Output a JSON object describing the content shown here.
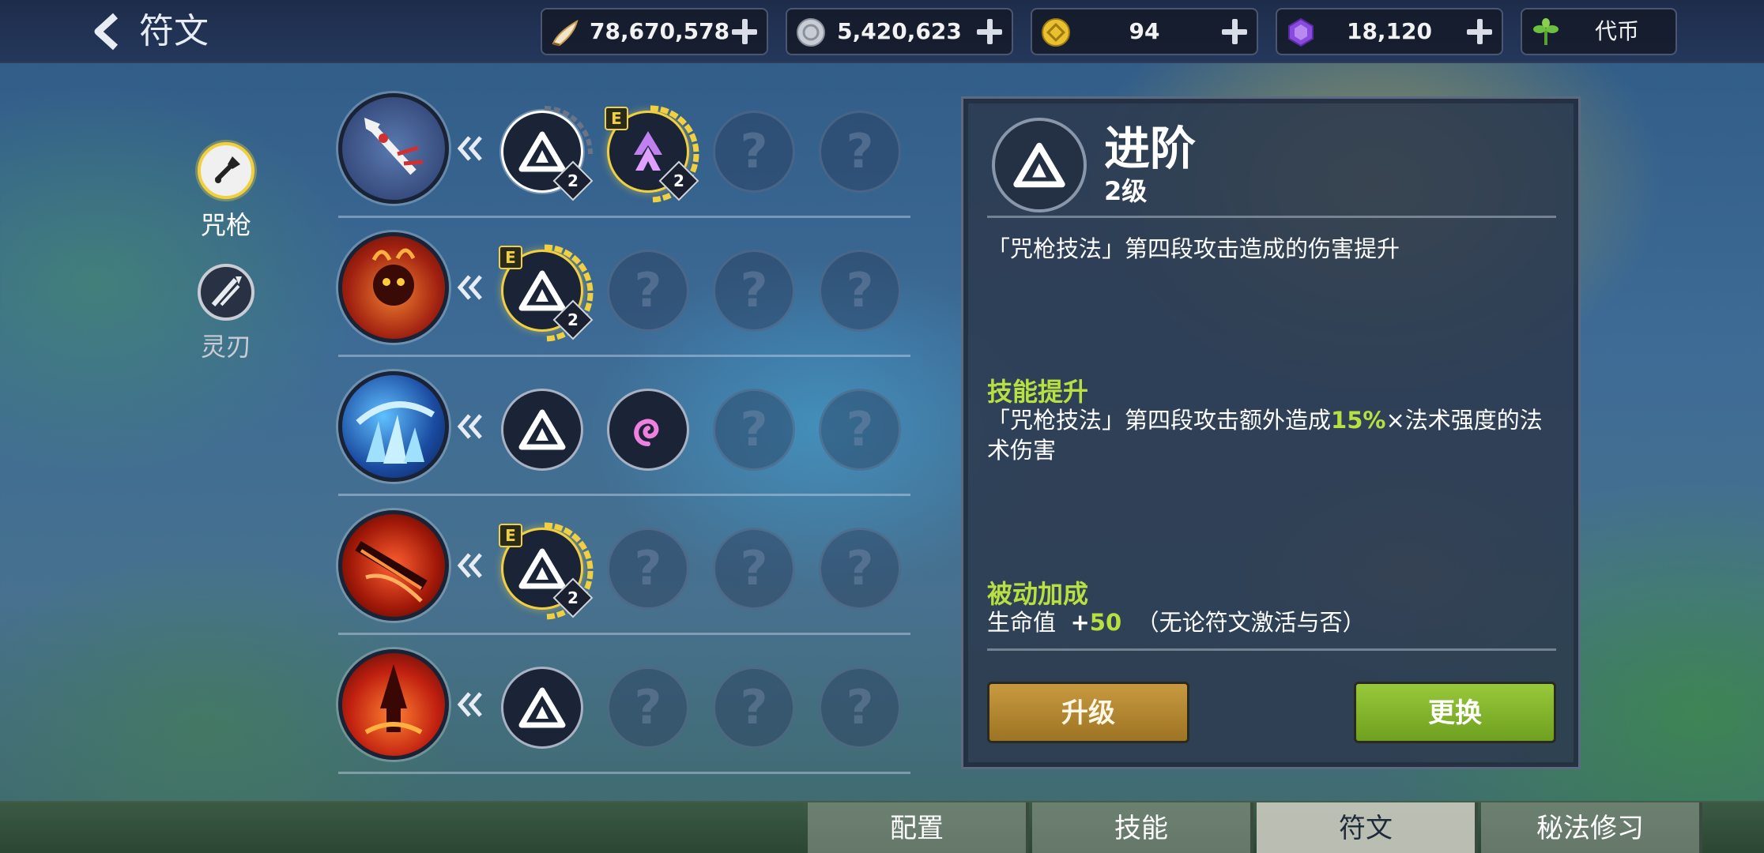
{
  "header": {
    "title": "符文",
    "currencies": [
      {
        "icon": "horn-currency-icon",
        "value": "78,670,578"
      },
      {
        "icon": "silver-coin-icon",
        "value": "5,420,623"
      },
      {
        "icon": "gold-coin-icon",
        "value": "94"
      },
      {
        "icon": "purple-gem-icon",
        "value": "18,120"
      },
      {
        "icon": "sprout-token-icon",
        "value": "代币"
      }
    ]
  },
  "weapons": [
    {
      "label": "咒枪",
      "selected": true
    },
    {
      "label": "灵刃",
      "selected": false
    }
  ],
  "rune_rows": [
    {
      "skill": "spear-skill-icon",
      "slots": [
        {
          "state": "filled",
          "icon": "advance-rune-icon",
          "level": "2",
          "selected": true
        },
        {
          "state": "filled",
          "icon": "purple-arrow-rune-icon",
          "level": "2",
          "badge": "E",
          "gold": true
        },
        {
          "state": "empty",
          "mark": "?"
        },
        {
          "state": "empty",
          "mark": "?"
        }
      ]
    },
    {
      "skill": "fire-spirit-skill-icon",
      "slots": [
        {
          "state": "filled",
          "icon": "advance-rune-icon",
          "level": "2",
          "badge": "E",
          "gold": true
        },
        {
          "state": "empty",
          "mark": "?"
        },
        {
          "state": "empty",
          "mark": "?"
        },
        {
          "state": "empty",
          "mark": "?"
        }
      ]
    },
    {
      "skill": "ice-skill-icon",
      "slots": [
        {
          "state": "filled",
          "icon": "advance-rune-icon"
        },
        {
          "state": "filled",
          "icon": "pink-swirl-rune-icon"
        },
        {
          "state": "empty",
          "mark": "?"
        },
        {
          "state": "empty",
          "mark": "?"
        }
      ]
    },
    {
      "skill": "flame-spear-skill-icon",
      "slots": [
        {
          "state": "filled",
          "icon": "advance-rune-icon",
          "level": "2",
          "badge": "E",
          "gold": true
        },
        {
          "state": "empty",
          "mark": "?"
        },
        {
          "state": "empty",
          "mark": "?"
        },
        {
          "state": "empty",
          "mark": "?"
        }
      ]
    },
    {
      "skill": "fire-pillar-skill-icon",
      "slots": [
        {
          "state": "filled",
          "icon": "advance-rune-icon"
        },
        {
          "state": "empty",
          "mark": "?"
        },
        {
          "state": "empty",
          "mark": "?"
        },
        {
          "state": "empty",
          "mark": "?"
        }
      ]
    }
  ],
  "detail": {
    "name": "进阶",
    "level": "2级",
    "description": "「咒枪技法」第四段攻击造成的伤害提升",
    "skill_up": {
      "title": "技能提升",
      "text_before": "「咒枪技法」第四段攻击额外造成",
      "highlight": "15%",
      "text_after": "×法术强度的法术伤害"
    },
    "passive": {
      "title": "被动加成",
      "stat": "生命值",
      "sign": "+",
      "value": "50",
      "note": "（无论符文激活与否）"
    },
    "upgrade_label": "升级",
    "swap_label": "更换"
  },
  "bottom_tabs": [
    {
      "label": "配置",
      "active": false
    },
    {
      "label": "技能",
      "active": false
    },
    {
      "label": "符文",
      "active": true
    },
    {
      "label": "秘法修习",
      "active": false
    }
  ],
  "colors": {
    "accent_green": "#b8e040",
    "gold_ring": "#f0d040",
    "upgrade_button": "#b0852e",
    "swap_button": "#86b42c"
  }
}
